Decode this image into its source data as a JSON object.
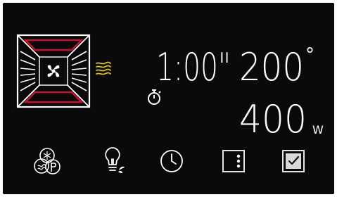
{
  "display": {
    "time": "1:00\"",
    "temperature": "200",
    "temperature_unit": "°",
    "power": "400",
    "power_unit": "W"
  },
  "colors": {
    "background": "#0a0a0a",
    "segment": "#ffffff",
    "heater": "#c8102e",
    "steam": "#e2c21a"
  },
  "icons": {
    "oven_mode": "oven-fan-heaters-icon",
    "steam": "steam-waves-icon",
    "timer": "stopwatch-icon",
    "function": "snowflake-defrost-p-icon",
    "light": "oven-light-bulb-icon",
    "clock": "clock-icon",
    "menu": "menu-dots-icon",
    "confirm": "checkbox-confirm-icon"
  }
}
